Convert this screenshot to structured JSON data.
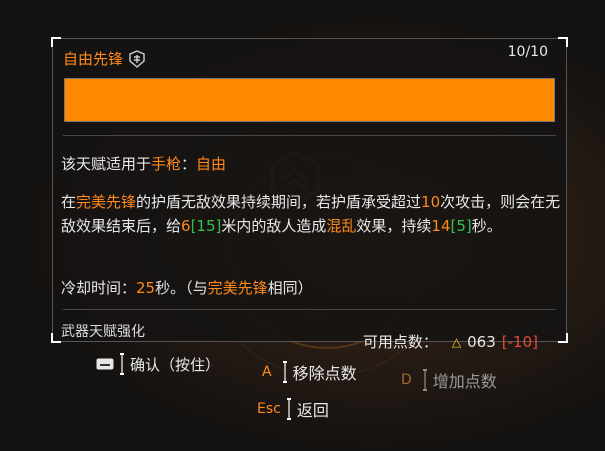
{
  "talent": {
    "title": "自由先锋",
    "count": "10/10",
    "progress": 1.0,
    "applies_prefix": "该天赋适用于",
    "applies_weapon": "手枪",
    "applies_colon": "：",
    "applies_name": "自由",
    "desc": {
      "p1": "在",
      "talent_ref": "完美先锋",
      "p2": "的护盾无敌效果持续期间，若护盾承受超过",
      "hits": "10",
      "p3": "次攻击，则会在无敌效果结束后，给",
      "range": "6",
      "range_bonus": "[15]",
      "p4": "米内的敌人造成",
      "effect": "混乱",
      "p5": "效果，持续",
      "duration": "14",
      "duration_bonus": "[5]",
      "p6": "秒。"
    },
    "cooldown": {
      "prefix": "冷却时间：",
      "value": "25",
      "suffix": "秒。（与",
      "ref": "完美先锋",
      "end": "相同）"
    },
    "enhance_label": "武器天赋强化",
    "points_label": "可用点数：",
    "points_value": "063",
    "points_delta": "[-10]"
  },
  "hints": {
    "confirm": "确认（按住）",
    "remove_key": "A",
    "remove": "移除点数",
    "add_key": "D",
    "add": "增加点数",
    "back_key": "Esc",
    "back": "返回"
  },
  "background": {
    "num1": "63",
    "num2": "63"
  },
  "colors": {
    "accent": "#ff8a1a",
    "bar": "#ff8a00",
    "green": "#36c24a",
    "red": "#e04a3a",
    "points_icon": "#f1d130"
  },
  "icons": {
    "talent": "shield-badge-icon",
    "points": "triangle-icon",
    "confirm": "mouse-icon"
  }
}
